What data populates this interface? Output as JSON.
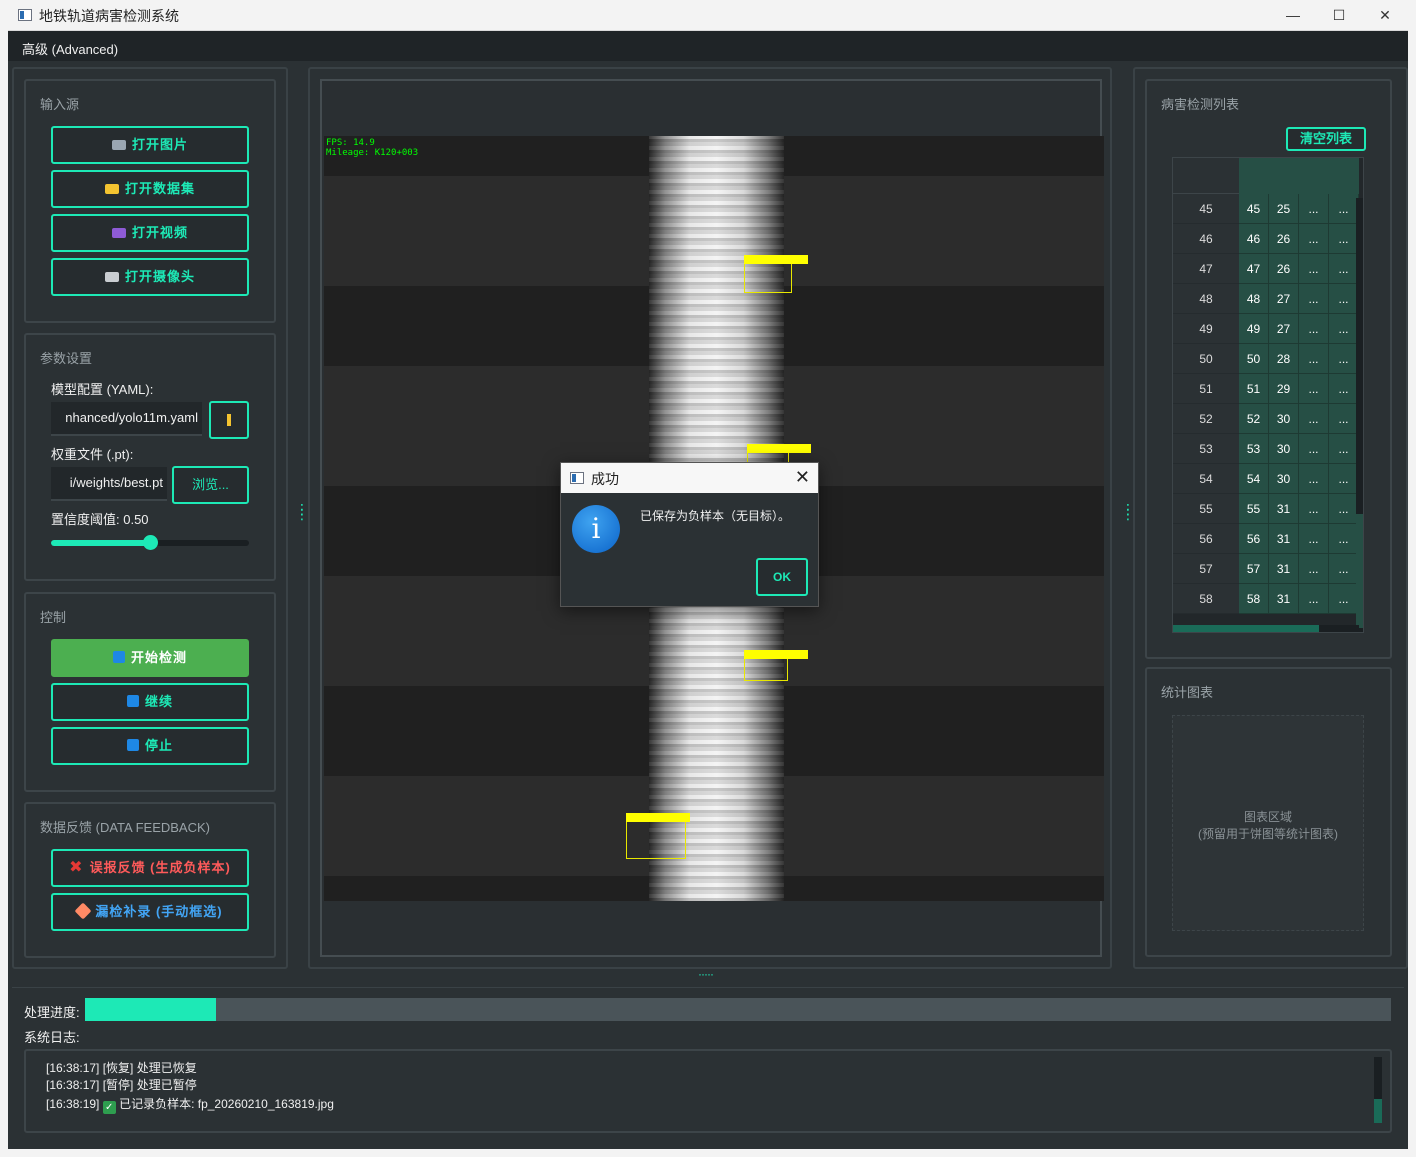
{
  "window": {
    "title": "地铁轨道病害检测系统",
    "minimize": "—",
    "maximize": "☐",
    "close": "✕"
  },
  "menu": {
    "advanced": "高级 (Advanced)"
  },
  "input_source": {
    "title": "输入源",
    "open_image": "打开图片",
    "open_dataset": "打开数据集",
    "open_video": "打开视频",
    "open_camera": "打开摄像头"
  },
  "params": {
    "title": "参数设置",
    "model_label": "模型配置 (YAML):",
    "model_value": "nhanced/yolo11m.yaml",
    "weights_label": "权重文件 (.pt):",
    "weights_value": "i/weights/best.pt",
    "browse": "浏览...",
    "confidence_label": "置信度阈值: 0.50",
    "confidence_value": 0.5
  },
  "control": {
    "title": "控制",
    "start": "开始检测",
    "resume": "继续",
    "stop": "停止"
  },
  "feedback": {
    "title": "数据反馈 (DATA FEEDBACK)",
    "false_report": "误报反馈 (生成负样本)",
    "missed_entry": "漏检补录 (手动框选)"
  },
  "video": {
    "fps": "FPS: 14.9",
    "mileage": "Mileage: K120+003"
  },
  "detection_list": {
    "title": "病害检测列表",
    "clear": "清空列表",
    "rows": [
      [
        "45",
        "45",
        "25",
        "...",
        "..."
      ],
      [
        "46",
        "46",
        "26",
        "...",
        "..."
      ],
      [
        "47",
        "47",
        "26",
        "...",
        "..."
      ],
      [
        "48",
        "48",
        "27",
        "...",
        "..."
      ],
      [
        "49",
        "49",
        "27",
        "...",
        "..."
      ],
      [
        "50",
        "50",
        "28",
        "...",
        "..."
      ],
      [
        "51",
        "51",
        "29",
        "...",
        "..."
      ],
      [
        "52",
        "52",
        "30",
        "...",
        "..."
      ],
      [
        "53",
        "53",
        "30",
        "...",
        "..."
      ],
      [
        "54",
        "54",
        "30",
        "...",
        "..."
      ],
      [
        "55",
        "55",
        "31",
        "...",
        "..."
      ],
      [
        "56",
        "56",
        "31",
        "...",
        "..."
      ],
      [
        "57",
        "57",
        "31",
        "...",
        "..."
      ],
      [
        "58",
        "58",
        "31",
        "...",
        "..."
      ]
    ]
  },
  "stats": {
    "title": "统计图表",
    "placeholder_line1": "图表区域",
    "placeholder_line2": "(预留用于饼图等统计图表)"
  },
  "progress": {
    "label": "处理进度:",
    "value": 0.1
  },
  "log": {
    "label": "系统日志:",
    "lines": [
      "[16:38:17] [恢复] 处理已恢复",
      "[16:38:17] [暂停] 处理已暂停",
      "[16:38:19]",
      "已记录负样本: fp_20260210_163819.jpg"
    ]
  },
  "dialog": {
    "title": "成功",
    "message": "已保存为负样本（无目标）。",
    "ok": "OK"
  }
}
